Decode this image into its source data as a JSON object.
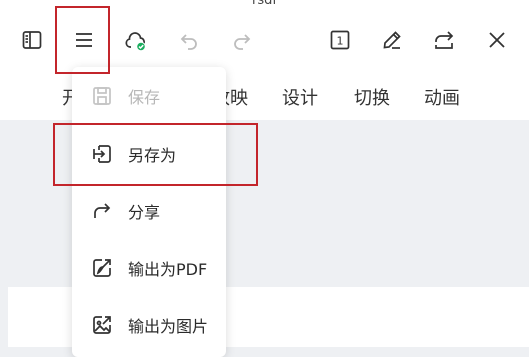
{
  "document": {
    "title": "rsdf"
  },
  "toolbar": {
    "icons": [
      "sidebar-panel-icon",
      "menu-icon",
      "cloud-sync-icon",
      "undo-icon",
      "redo-icon",
      "page-number-icon",
      "pen-edit-icon",
      "share-icon",
      "close-icon"
    ],
    "page_indicator": "1",
    "accent_green": "#1aad5f",
    "highlight_red": "#c3252b"
  },
  "ribbon_tabs": [
    {
      "label": "开"
    },
    {
      "label": "放映"
    },
    {
      "label": "设计"
    },
    {
      "label": "切换"
    },
    {
      "label": "动画"
    }
  ],
  "file_menu": {
    "items": [
      {
        "label": "保存",
        "icon": "save-icon",
        "enabled": false
      },
      {
        "label": "另存为",
        "icon": "save-as-icon",
        "enabled": true
      },
      {
        "label": "分享",
        "icon": "share-icon",
        "enabled": true
      },
      {
        "label": "输出为PDF",
        "icon": "export-pdf-icon",
        "enabled": true
      },
      {
        "label": "输出为图片",
        "icon": "export-image-icon",
        "enabled": true
      }
    ]
  }
}
